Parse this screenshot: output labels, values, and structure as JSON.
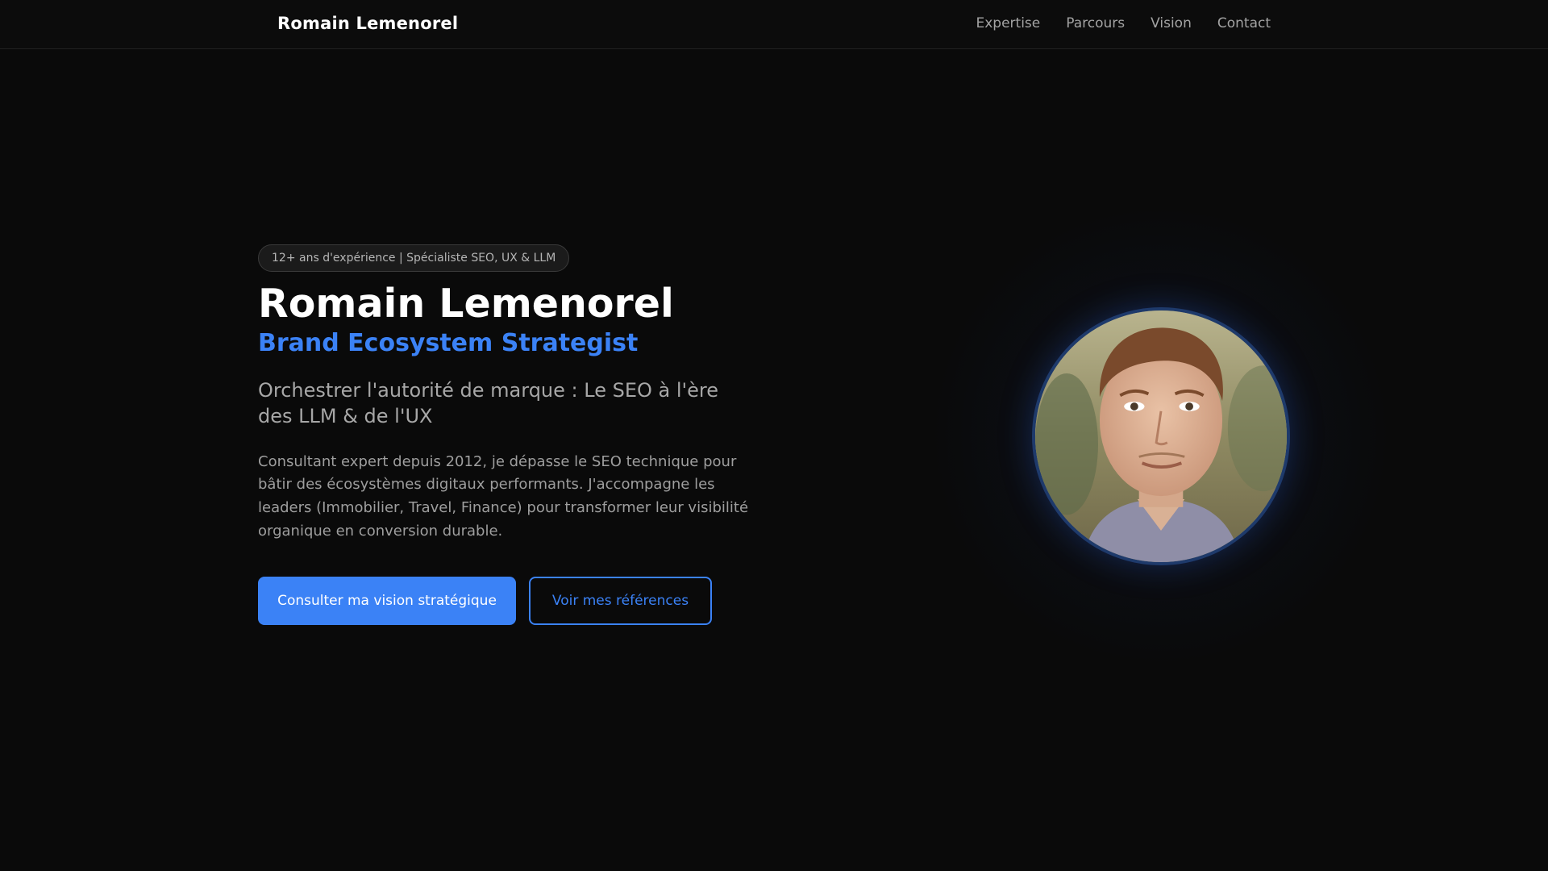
{
  "nav": {
    "brand": "Romain Lemenorel",
    "links": [
      "Expertise",
      "Parcours",
      "Vision",
      "Contact"
    ]
  },
  "hero": {
    "badge": "12+ ans d'expérience | Spécialiste SEO, UX & LLM",
    "title": "Romain Lemenorel",
    "subtitle": "Brand Ecosystem Strategist",
    "tagline": "Orchestrer l'autorité de marque : Le SEO à l'ère des LLM & de l'UX",
    "description": "Consultant expert depuis 2012, je dépasse le SEO technique pour bâtir des écosystèmes digitaux performants. J'accompagne les leaders (Immobilier, Travel, Finance) pour transformer leur visibilité organique en conversion durable.",
    "primary_cta": "Consulter ma vision stratégique",
    "secondary_cta": "Voir mes références"
  },
  "colors": {
    "background": "#0a0a0a",
    "accent": "#3b82f6",
    "text_muted": "#a3a3a3"
  }
}
